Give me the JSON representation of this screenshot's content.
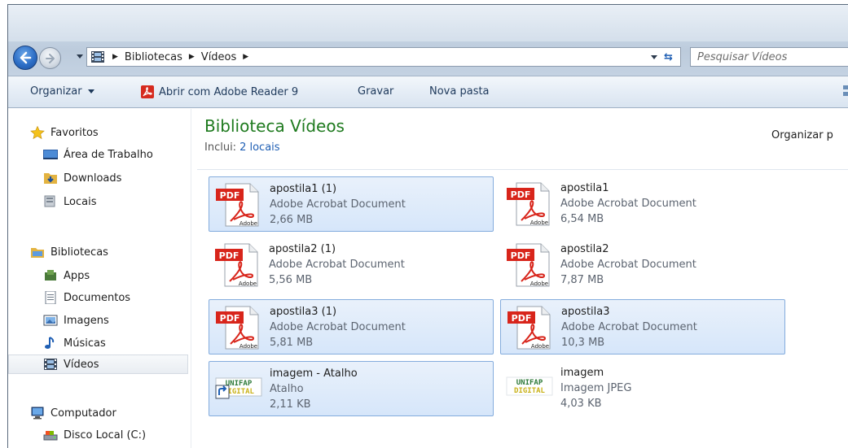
{
  "address": {
    "crumbs": [
      "Bibliotecas",
      "Vídeos"
    ],
    "search_placeholder": "Pesquisar Vídeos"
  },
  "toolbar": {
    "organize": "Organizar",
    "open_with": "Abrir com Adobe Reader 9",
    "burn": "Gravar",
    "new_folder": "Nova pasta"
  },
  "nav": {
    "favorites": "Favoritos",
    "desktop": "Área de Trabalho",
    "downloads": "Downloads",
    "places": "Locais",
    "libraries": "Bibliotecas",
    "apps": "Apps",
    "documents": "Documentos",
    "pictures": "Imagens",
    "music": "Músicas",
    "videos": "Vídeos",
    "computer": "Computador",
    "local_disk": "Disco Local (C:)"
  },
  "library": {
    "title": "Biblioteca Vídeos",
    "includes_label": "Inclui:",
    "includes_link": "2 locais",
    "arrange_by": "Organizar p"
  },
  "files": [
    {
      "name": "apostila1 (1)",
      "type": "Adobe Acrobat Document",
      "size": "2,66 MB"
    },
    {
      "name": "apostila1",
      "type": "Adobe Acrobat Document",
      "size": "6,54 MB"
    },
    {
      "name": "apostila2 (1)",
      "type": "Adobe Acrobat Document",
      "size": "5,56 MB"
    },
    {
      "name": "apostila2",
      "type": "Adobe Acrobat Document",
      "size": "7,87 MB"
    },
    {
      "name": "apostila3 (1)",
      "type": "Adobe Acrobat Document",
      "size": "5,81 MB"
    },
    {
      "name": "apostila3",
      "type": "Adobe Acrobat Document",
      "size": "10,3 MB"
    },
    {
      "name": "imagem - Atalho",
      "type": "Atalho",
      "size": "2,11 KB"
    },
    {
      "name": "imagem",
      "type": "Imagem JPEG",
      "size": "4,03 KB"
    }
  ],
  "icons": {
    "pdf_badge": "PDF",
    "adobe_label": "Adobe",
    "unifap_top": "UNIFAP",
    "unifap_bottom": "DIGITAL"
  },
  "colors": {
    "library_title": "#1e7a1e",
    "link": "#1f5fb4",
    "selection_border": "#84acdd"
  }
}
